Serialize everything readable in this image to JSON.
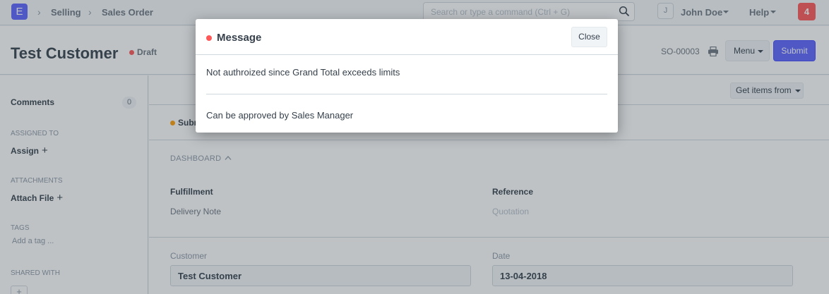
{
  "navbar": {
    "logo_letter": "E",
    "breadcrumbs": [
      "Selling",
      "Sales Order"
    ],
    "search_placeholder": "Search or type a command (Ctrl + G)",
    "avatar_initial": "J",
    "user_name": "John Doe",
    "help_label": "Help",
    "notification_count": "4"
  },
  "page_head": {
    "title": "Test Customer",
    "status": "Draft",
    "doc_name": "SO-00003",
    "menu_label": "Menu",
    "submit_label": "Submit"
  },
  "sidebar": {
    "comments_label": "Comments",
    "comments_count": "0",
    "assigned_to_heading": "ASSIGNED TO",
    "assign_label": "Assign",
    "attachments_heading": "ATTACHMENTS",
    "attach_label": "Attach File",
    "tags_heading": "TAGS",
    "add_tag_label": "Add a tag ...",
    "shared_with_heading": "SHARED WITH",
    "plus": "+"
  },
  "main": {
    "get_items_label": "Get items from",
    "status_partial": "Subm",
    "dashboard_label": "DASHBOARD",
    "fulfillment_heading": "Fulfillment",
    "fulfillment_link": "Delivery Note",
    "reference_heading": "Reference",
    "reference_link": "Quotation",
    "customer_label": "Customer",
    "customer_value": "Test Customer",
    "date_label": "Date",
    "date_value": "13-04-2018"
  },
  "modal": {
    "title": "Message",
    "close_label": "Close",
    "message_line1": "Not authroized since Grand Total exceeds limits",
    "message_line2": "Can be approved by Sales Manager"
  },
  "colors": {
    "primary": "#5e64ff",
    "danger": "#ff5858",
    "warning": "#ffa00a",
    "text": "#36414c",
    "muted": "#8d99a6"
  }
}
